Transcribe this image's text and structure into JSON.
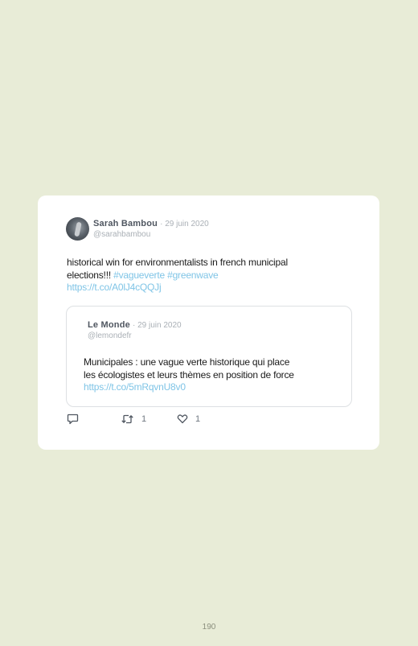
{
  "tweet": {
    "author_name": "Sarah Bambou",
    "date": "· 29 juin 2020",
    "handle": "@sarahbambou",
    "text_line1": "historical win for environmentalists in french municipal",
    "text_line2_prefix": "elections!!! ",
    "hashtag1": "#vagueverte",
    "hashtag2": "#greenwave",
    "link": "https://t.co/A0lJ4cQQJj",
    "quoted": {
      "author_name": "Le Monde",
      "date": "· 29 juin 2020",
      "handle": "@lemondefr",
      "text_line1": "Municipales : une vague verte historique qui place",
      "text_line2": "les écologistes et leurs thèmes en position de force",
      "link": "https://t.co/5mRqvnU8v0"
    },
    "actions": {
      "reply_icon": "reply-icon",
      "retweet_icon": "retweet-icon",
      "retweet_count": "1",
      "like_icon": "heart-icon",
      "like_count": "1"
    }
  },
  "colors": {
    "background": "#e8ecd7",
    "card": "#ffffff",
    "link": "#7fc4e6"
  },
  "page": {
    "number": "190"
  }
}
